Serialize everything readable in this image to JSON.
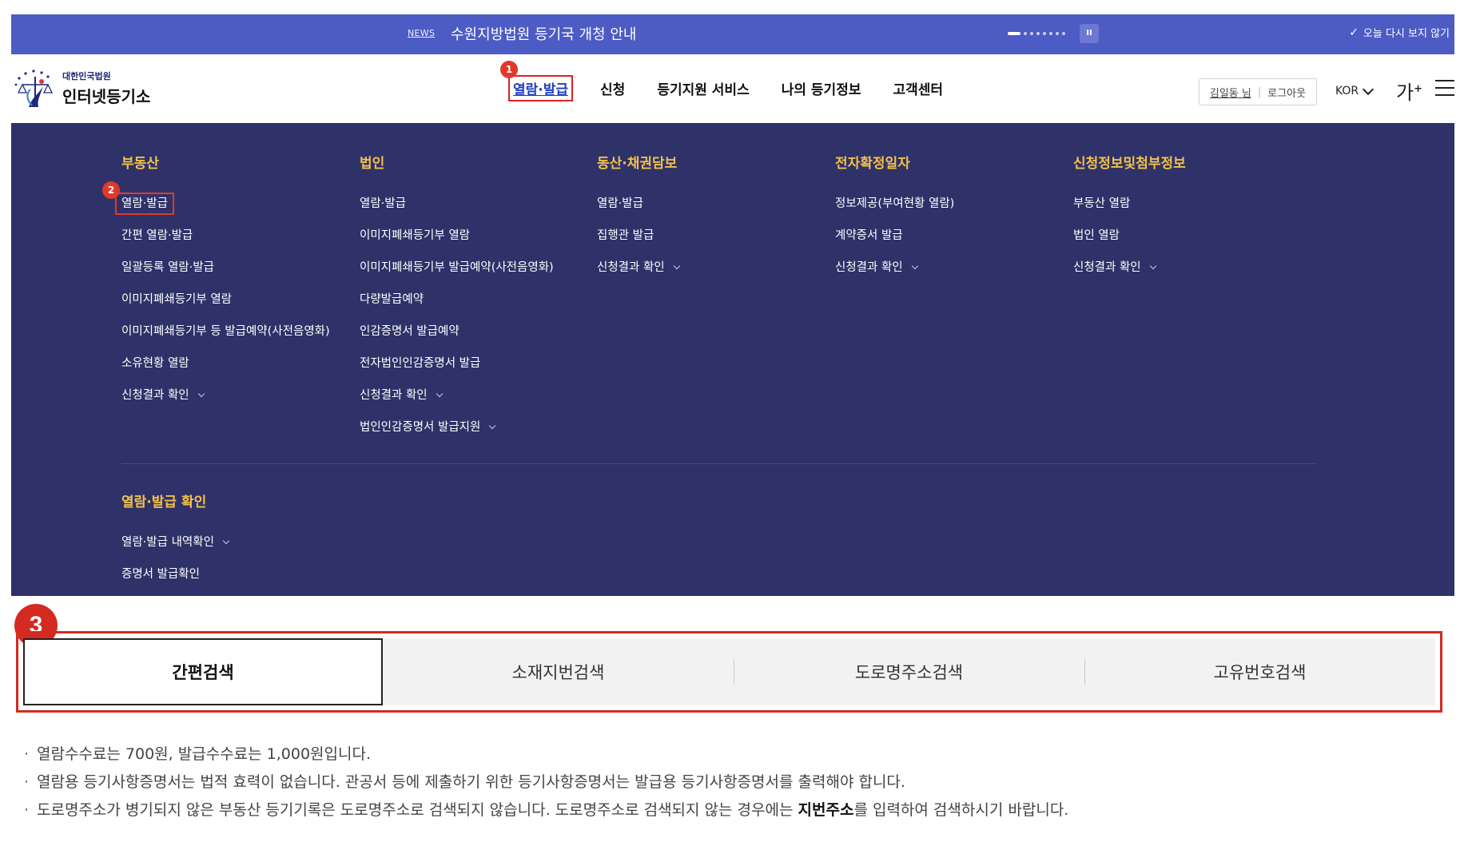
{
  "banner": {
    "news_tag": "NEWS",
    "news_text": "수원지방법원 등기국 개청 안내",
    "pause_label": "II",
    "close_today_label": "오늘 다시 보지 않기",
    "dots_total": 8,
    "dot_active_index": 0
  },
  "header": {
    "logo_sub": "대한민국법원",
    "logo_main": "인터넷등기소",
    "nav": [
      {
        "label": "열람·발급"
      },
      {
        "label": "신청"
      },
      {
        "label": "등기지원 서비스"
      },
      {
        "label": "나의 등기정보"
      },
      {
        "label": "고객센터"
      }
    ],
    "user_name": "김일동 님",
    "logout_label": "로그아웃",
    "lang_label": "KOR",
    "font_size_label": "가",
    "font_size_plus": "+"
  },
  "badges": {
    "one": "1",
    "two": "2",
    "three": "3"
  },
  "mega_menu": {
    "columns": [
      {
        "title": "부동산",
        "items": [
          "열람·발급",
          "간편 열람·발급",
          "일괄등록 열람·발급",
          "이미지폐쇄등기부 열람",
          "이미지폐쇄등기부 등 발급예약(사전음영화)",
          "소유현황 열람",
          "신청결과 확인"
        ]
      },
      {
        "title": "법인",
        "items": [
          "열람·발급",
          "이미지폐쇄등기부 열람",
          "이미지폐쇄등기부 발급예약(사전음영화)",
          "다량발급예약",
          "인감증명서 발급예약",
          "전자법인인감증명서 발급",
          "신청결과 확인",
          "법인인감증명서 발급지원"
        ]
      },
      {
        "title": "동산·채권담보",
        "items": [
          "열람·발급",
          "집행관 발급",
          "신청결과 확인"
        ]
      },
      {
        "title": "전자확정일자",
        "items": [
          "정보제공(부여현황 열람)",
          "계약증서 발급",
          "신청결과 확인"
        ]
      },
      {
        "title": "신청정보및첨부정보",
        "items": [
          "부동산 열람",
          "법인 열람",
          "신청결과 확인"
        ]
      }
    ],
    "bottom": {
      "title": "열람·발급 확인",
      "items": [
        "열람·발급 내역확인",
        "증명서 발급확인"
      ]
    }
  },
  "search_tabs": [
    {
      "label": "간편검색"
    },
    {
      "label": "소재지번검색"
    },
    {
      "label": "도로명주소검색"
    },
    {
      "label": "고유번호검색"
    }
  ],
  "notes": {
    "bullet": "·",
    "n1": "열람수수료는  700원, 발급수수료는  1,000원입니다.",
    "n2": "열람용 등기사항증명서는 법적 효력이 없습니다. 관공서 등에 제출하기 위한 등기사항증명서는 발급용 등기사항증명서를 출력해야 합니다.",
    "n3_a": "도로명주소가 병기되지 않은 부동산 등기기록은 도로명주소로 검색되지 않습니다. 도로명주소로 검색되지 않는 경우에는 ",
    "n3_b": "지번주소",
    "n3_c": "를 입력하여 검색하시기 바랍니다."
  },
  "colors": {
    "banner": "#4d5bc4",
    "mega_bg": "#2e3268",
    "menu_title": "#f3c04b",
    "highlight": "#d42a20",
    "active_nav": "#1f3dc4"
  }
}
